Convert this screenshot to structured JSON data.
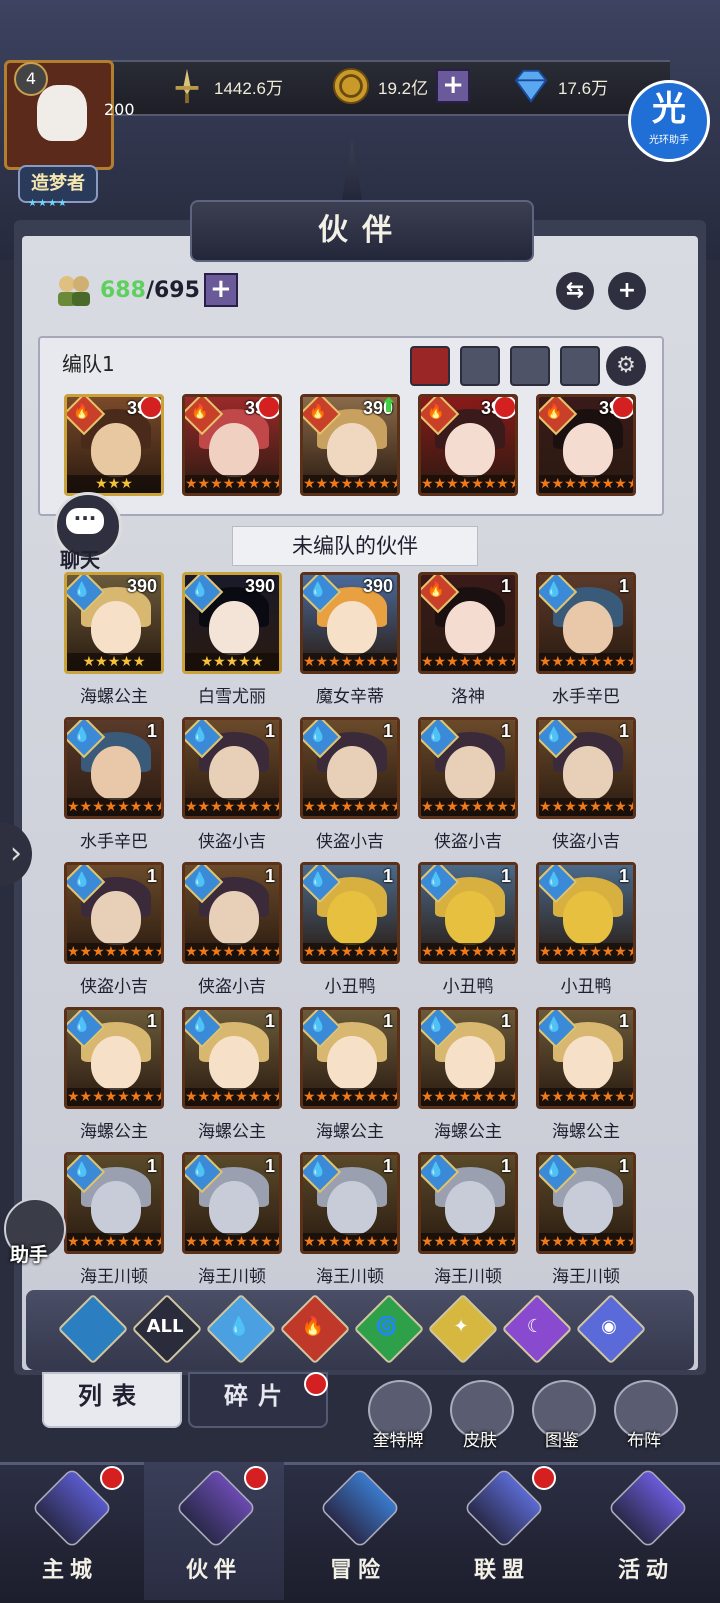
{
  "resources": {
    "power": "1442.6万",
    "gold": "19.2亿",
    "diamond": "17.6万"
  },
  "player": {
    "level": "4",
    "number": "200",
    "title": "造梦者",
    "stars": "★★★★"
  },
  "assistant": {
    "big": "光",
    "small": "光环助手"
  },
  "panel_title": "伙伴",
  "partner_count": {
    "current": "688",
    "max": "/695"
  },
  "team": {
    "label": "编队1",
    "members": [
      {
        "level": "390",
        "palette": "brown",
        "dot": "red",
        "stars": "★★★",
        "gold": true
      },
      {
        "level": "390",
        "palette": "red",
        "dot": "red",
        "stars": "★★★★★★★★",
        "gold": false
      },
      {
        "level": "390",
        "palette": "tan",
        "dot": "green",
        "stars": "★★★★★★★★",
        "gold": false
      },
      {
        "level": "390",
        "palette": "crimson",
        "dot": "red",
        "stars": "★★★★★★★★",
        "gold": false
      },
      {
        "level": "390",
        "palette": "black",
        "dot": "red",
        "stars": "★★★★★★★★",
        "gold": false
      }
    ]
  },
  "chat_label": "聊天",
  "unassigned_label": "未编队的伙伴",
  "partners": [
    {
      "name": "海螺公主",
      "level": "390",
      "palette": "blonde",
      "gold": true,
      "stars": "★★★★★"
    },
    {
      "name": "白雪尤丽",
      "level": "390",
      "palette": "snow",
      "gold": true,
      "stars": "★★★★★"
    },
    {
      "name": "魔女辛蒂",
      "level": "390",
      "palette": "orange",
      "gold": false,
      "stars": "★★★★★★★★"
    },
    {
      "name": "洛神",
      "level": "1",
      "palette": "black",
      "gold": false,
      "stars": "★★★★★★★★"
    },
    {
      "name": "水手辛巴",
      "level": "1",
      "palette": "sailor",
      "gold": false,
      "stars": "★★★★★★★★"
    },
    {
      "name": "水手辛巴",
      "level": "1",
      "palette": "sailor",
      "gold": false,
      "stars": "★★★★★★★★"
    },
    {
      "name": "侠盗小吉",
      "level": "1",
      "palette": "thief",
      "gold": false,
      "stars": "★★★★★★★★"
    },
    {
      "name": "侠盗小吉",
      "level": "1",
      "palette": "thief",
      "gold": false,
      "stars": "★★★★★★★★"
    },
    {
      "name": "侠盗小吉",
      "level": "1",
      "palette": "thief",
      "gold": false,
      "stars": "★★★★★★★★"
    },
    {
      "name": "侠盗小吉",
      "level": "1",
      "palette": "thief",
      "gold": false,
      "stars": "★★★★★★★★"
    },
    {
      "name": "侠盗小吉",
      "level": "1",
      "palette": "thief",
      "gold": false,
      "stars": "★★★★★★★★"
    },
    {
      "name": "侠盗小吉",
      "level": "1",
      "palette": "thief",
      "gold": false,
      "stars": "★★★★★★★★"
    },
    {
      "name": "小丑鸭",
      "level": "1",
      "palette": "duck",
      "gold": false,
      "stars": "★★★★★★★★"
    },
    {
      "name": "小丑鸭",
      "level": "1",
      "palette": "duck",
      "gold": false,
      "stars": "★★★★★★★★"
    },
    {
      "name": "小丑鸭",
      "level": "1",
      "palette": "duck",
      "gold": false,
      "stars": "★★★★★★★★"
    },
    {
      "name": "海螺公主",
      "level": "1",
      "palette": "blonde",
      "gold": false,
      "stars": "★★★★★★★★"
    },
    {
      "name": "海螺公主",
      "level": "1",
      "palette": "blonde",
      "gold": false,
      "stars": "★★★★★★★★"
    },
    {
      "name": "海螺公主",
      "level": "1",
      "palette": "blonde",
      "gold": false,
      "stars": "★★★★★★★★"
    },
    {
      "name": "海螺公主",
      "level": "1",
      "palette": "blonde",
      "gold": false,
      "stars": "★★★★★★★★"
    },
    {
      "name": "海螺公主",
      "level": "1",
      "palette": "blonde",
      "gold": false,
      "stars": "★★★★★★★★"
    },
    {
      "name": "海王川顿",
      "level": "1",
      "palette": "king",
      "gold": false,
      "stars": "★★★★★★★★"
    },
    {
      "name": "海王川顿",
      "level": "1",
      "palette": "king",
      "gold": false,
      "stars": "★★★★★★★★"
    },
    {
      "name": "海王川顿",
      "level": "1",
      "palette": "king",
      "gold": false,
      "stars": "★★★★★★★★"
    },
    {
      "name": "海王川顿",
      "level": "1",
      "palette": "king",
      "gold": false,
      "stars": "★★★★★★★★"
    },
    {
      "name": "海王川顿",
      "level": "1",
      "palette": "king",
      "gold": false,
      "stars": "★★★★★★★★"
    }
  ],
  "filters": [
    {
      "name": "all-elements-filter",
      "label": "",
      "color": "#2b7fc0"
    },
    {
      "name": "all-filter",
      "label": "ALL",
      "color": "#2a2c3c"
    },
    {
      "name": "water-filter",
      "label": "💧",
      "color": "#4aa0e0"
    },
    {
      "name": "fire-filter",
      "label": "🔥",
      "color": "#c0382a"
    },
    {
      "name": "wind-filter",
      "label": "🌀",
      "color": "#2fa04a"
    },
    {
      "name": "light-filter",
      "label": "✦",
      "color": "#d6b840"
    },
    {
      "name": "dark-filter",
      "label": "☾",
      "color": "#8a4ad0"
    },
    {
      "name": "planet-filter",
      "label": "◉",
      "color": "#5a6ad8"
    }
  ],
  "subtabs": {
    "list": "列表",
    "shards": "碎片"
  },
  "side_actions": [
    {
      "label": "奎特牌",
      "name": "quest-cards"
    },
    {
      "label": "皮肤",
      "name": "skins"
    },
    {
      "label": "图鉴",
      "name": "codex"
    },
    {
      "label": "布阵",
      "name": "formation"
    }
  ],
  "helper_label": "助手",
  "nav": [
    {
      "label": "主城",
      "name": "main-city",
      "dot": true
    },
    {
      "label": "伙伴",
      "name": "partners",
      "dot": true
    },
    {
      "label": "冒险",
      "name": "adventure",
      "dot": false
    },
    {
      "label": "联盟",
      "name": "alliance",
      "dot": true
    },
    {
      "label": "活动",
      "name": "events",
      "dot": false
    }
  ]
}
